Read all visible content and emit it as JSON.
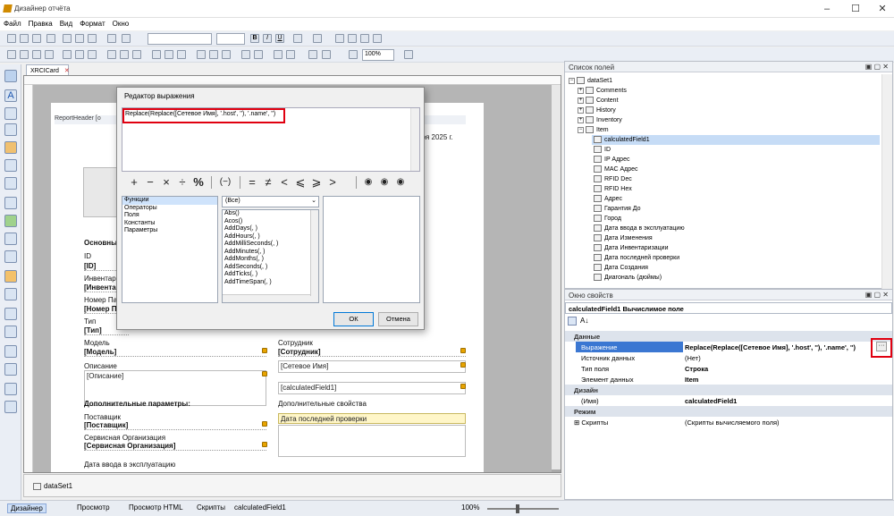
{
  "window": {
    "title": "Дизайнер отчёта"
  },
  "menu": [
    "Файл",
    "Правка",
    "Вид",
    "Формат",
    "Окно"
  ],
  "toolbar": {
    "zoom": "100%"
  },
  "doc_tab": "XRCICard",
  "report": {
    "band_header": "ReportHeader [о",
    "date_text": "бря 2025 г.",
    "section_basic": "Основные",
    "id_label": "ID",
    "id_field": "[ID]",
    "inv_label": "Инвентар",
    "inv_field": "[Инвента",
    "num_label": "Номер Пар",
    "num_field": "[Номер П",
    "type_label": "Тип",
    "type_field": "[Тип]",
    "model_label": "Модель",
    "model_field": "[Модель]",
    "employee_label": "Сотрудник",
    "employee_field": "[Сотрудник]",
    "desc_label": "Описание",
    "desc_field": "[Описание]",
    "netname_field": "[Сетевое Имя]",
    "calc_field": "[calculatedField1]",
    "extra_params": "Дополнительные параметры:",
    "extra_props": "Дополнительные свойства",
    "supplier_label": "Поставщик",
    "supplier_field": "[Поставщик]",
    "service_label": "Сервисная Организация",
    "service_field": "[Сервисная Организация]",
    "lastcheck": "Дата последней проверки",
    "commission": "Дата ввода в эксплуатацию"
  },
  "bottom_tab": "dataSet1",
  "status": {
    "designer": "Дизайнер",
    "preview": "Просмотр",
    "preview_html": "Просмотр HTML",
    "scripts": "Скрипты",
    "current": "calculatedField1",
    "zoom": "100%"
  },
  "dialog": {
    "title": "Редактор выражения",
    "expression": "Replace(Replace([Сетевое Имя], '.host', ''), '.name', '')",
    "operators": [
      "+",
      "−",
      "×",
      "÷",
      "%",
      "(−)",
      "=",
      "≠",
      "<",
      "⩽",
      "⩾",
      ">"
    ],
    "categories": [
      "Функции",
      "Операторы",
      "Поля",
      "Константы",
      "Параметры"
    ],
    "filter": "(Все)",
    "functions": [
      "Abs()",
      "Acos()",
      "AddDays(, )",
      "AddHours(, )",
      "AddMilliSeconds(, )",
      "AddMinutes(, )",
      "AddMonths(, )",
      "AddSeconds(, )",
      "AddTicks(, )",
      "AddTimeSpan(, )"
    ],
    "ok": "ОК",
    "cancel": "Отмена"
  },
  "fields_panel": {
    "title": "Список полей",
    "root": "dataSet1",
    "groups": [
      "Comments",
      "Content",
      "History",
      "Inventory",
      "Item"
    ],
    "items": [
      "calculatedField1",
      "ID",
      "IP Адрес",
      "MAC Адрес",
      "RFID Dec",
      "RFID Hex",
      "Адрес",
      "Гарантия До",
      "Город",
      "Дата ввода в эксплуатацию",
      "Дата Изменения",
      "Дата Инвентаризации",
      "Дата последней проверки",
      "Дата Создания",
      "Диагональ (дюймы)"
    ]
  },
  "props_panel": {
    "title": "Окно свойств",
    "object": "calculatedField1",
    "object_type": "Вычислимое поле",
    "cat_data": "Данные",
    "rows": [
      {
        "name": "Выражение",
        "value": "Replace(Replace([Сетевое Имя], '.host', ''), '.name', '')"
      },
      {
        "name": "Источник данных",
        "value": "(Нет)"
      },
      {
        "name": "Тип поля",
        "value": "Строка"
      },
      {
        "name": "Элемент данных",
        "value": "Item"
      }
    ],
    "cat_design": "Дизайн",
    "design_name": "(Имя)",
    "design_value": "calculatedField1",
    "cat_modes": "Режим",
    "scripts_name": "Скрипты",
    "scripts_value": "(Скрипты вычисляемого поля)",
    "ellipsis": "···"
  },
  "colors": {
    "highlight": "#e00010",
    "selection": "#3b77d2"
  }
}
